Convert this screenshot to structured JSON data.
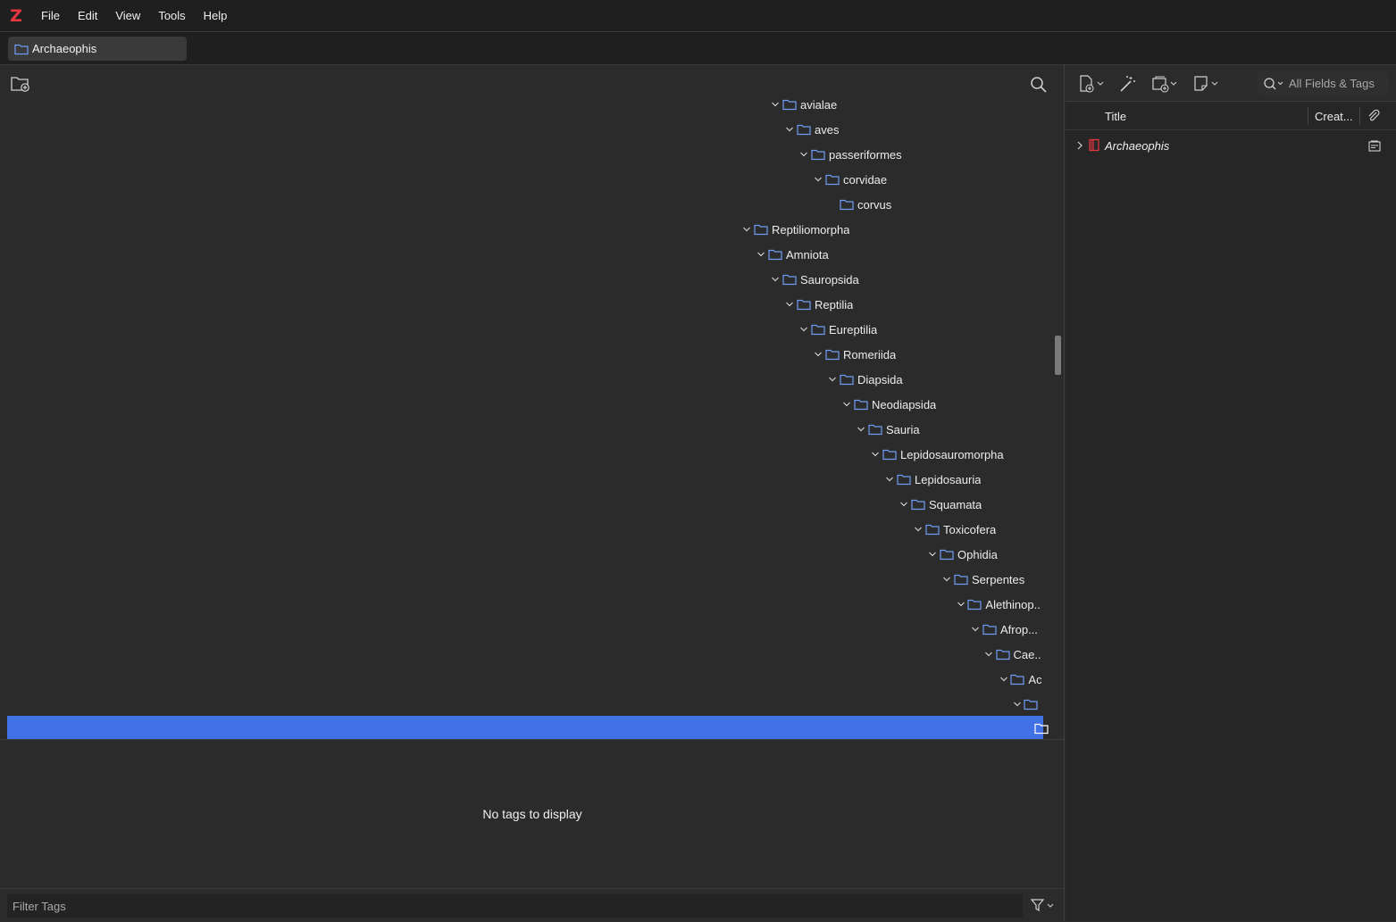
{
  "app": {
    "logo_letter": "Z",
    "accent_color": "#e5363d",
    "selection_color": "#4072e5",
    "folder_icon_color": "#6f9cf5"
  },
  "menu": {
    "items": [
      "File",
      "Edit",
      "View",
      "Tools",
      "Help"
    ]
  },
  "tab": {
    "label": "Archaeophis",
    "icon": "folder-icon"
  },
  "collections_pane": {
    "toolbar": {
      "new_collection_icon": "new-collection-icon",
      "search_icon": "search-icon"
    },
    "tree": [
      {
        "label": "avialae",
        "level": 3,
        "expanded": true
      },
      {
        "label": "aves",
        "level": 4,
        "expanded": true
      },
      {
        "label": "passeriformes",
        "level": 5,
        "expanded": true
      },
      {
        "label": "corvidae",
        "level": 6,
        "expanded": true
      },
      {
        "label": "corvus",
        "level": 7,
        "expanded": false
      },
      {
        "label": "Reptiliomorpha",
        "level": 1,
        "expanded": true
      },
      {
        "label": "Amniota",
        "level": 2,
        "expanded": true
      },
      {
        "label": "Sauropsida",
        "level": 3,
        "expanded": true
      },
      {
        "label": "Reptilia",
        "level": 4,
        "expanded": true
      },
      {
        "label": "Eureptilia",
        "level": 5,
        "expanded": true
      },
      {
        "label": "Romeriida",
        "level": 6,
        "expanded": true
      },
      {
        "label": "Diapsida",
        "level": 7,
        "expanded": true
      },
      {
        "label": "Neodiapsida",
        "level": 8,
        "expanded": true
      },
      {
        "label": "Sauria",
        "level": 9,
        "expanded": true
      },
      {
        "label": "Lepidosauromorpha",
        "level": 10,
        "expanded": true
      },
      {
        "label": "Lepidosauria",
        "level": 11,
        "expanded": true
      },
      {
        "label": "Squamata",
        "level": 12,
        "expanded": true
      },
      {
        "label": "Toxicofera",
        "level": 13,
        "expanded": true
      },
      {
        "label": "Ophidia",
        "level": 14,
        "expanded": true
      },
      {
        "label": "Serpentes",
        "level": 15,
        "expanded": true
      },
      {
        "label": "Alethinop...",
        "level": 16,
        "expanded": true
      },
      {
        "label": "Afrop...",
        "level": 17,
        "expanded": true
      },
      {
        "label": "Cae...",
        "level": 18,
        "expanded": true
      },
      {
        "label": "Ac",
        "level": 19,
        "expanded": true
      },
      {
        "label": "",
        "level": 20,
        "expanded": true
      }
    ],
    "selected_row": {
      "label": "",
      "level": 21
    }
  },
  "tag_selector": {
    "empty_message": "No tags to display",
    "filter_placeholder": "Filter Tags",
    "filter_value": "",
    "actions_icon": "filter-icon"
  },
  "items_pane": {
    "toolbar": {
      "new_item_icon": "new-item-icon",
      "add_by_identifier_icon": "magic-wand-icon",
      "new_attachment_icon": "attachment-add-icon",
      "new_note_icon": "note-icon"
    },
    "search": {
      "mode_icon": "search-icon",
      "placeholder": "All Fields & Tags",
      "value": ""
    },
    "columns": {
      "title": "Title",
      "creator": "Creat...",
      "attachment_icon": "paperclip-icon"
    },
    "items": [
      {
        "title": "Archaeophis",
        "type_icon": "book-icon",
        "has_attachment": true
      }
    ]
  }
}
